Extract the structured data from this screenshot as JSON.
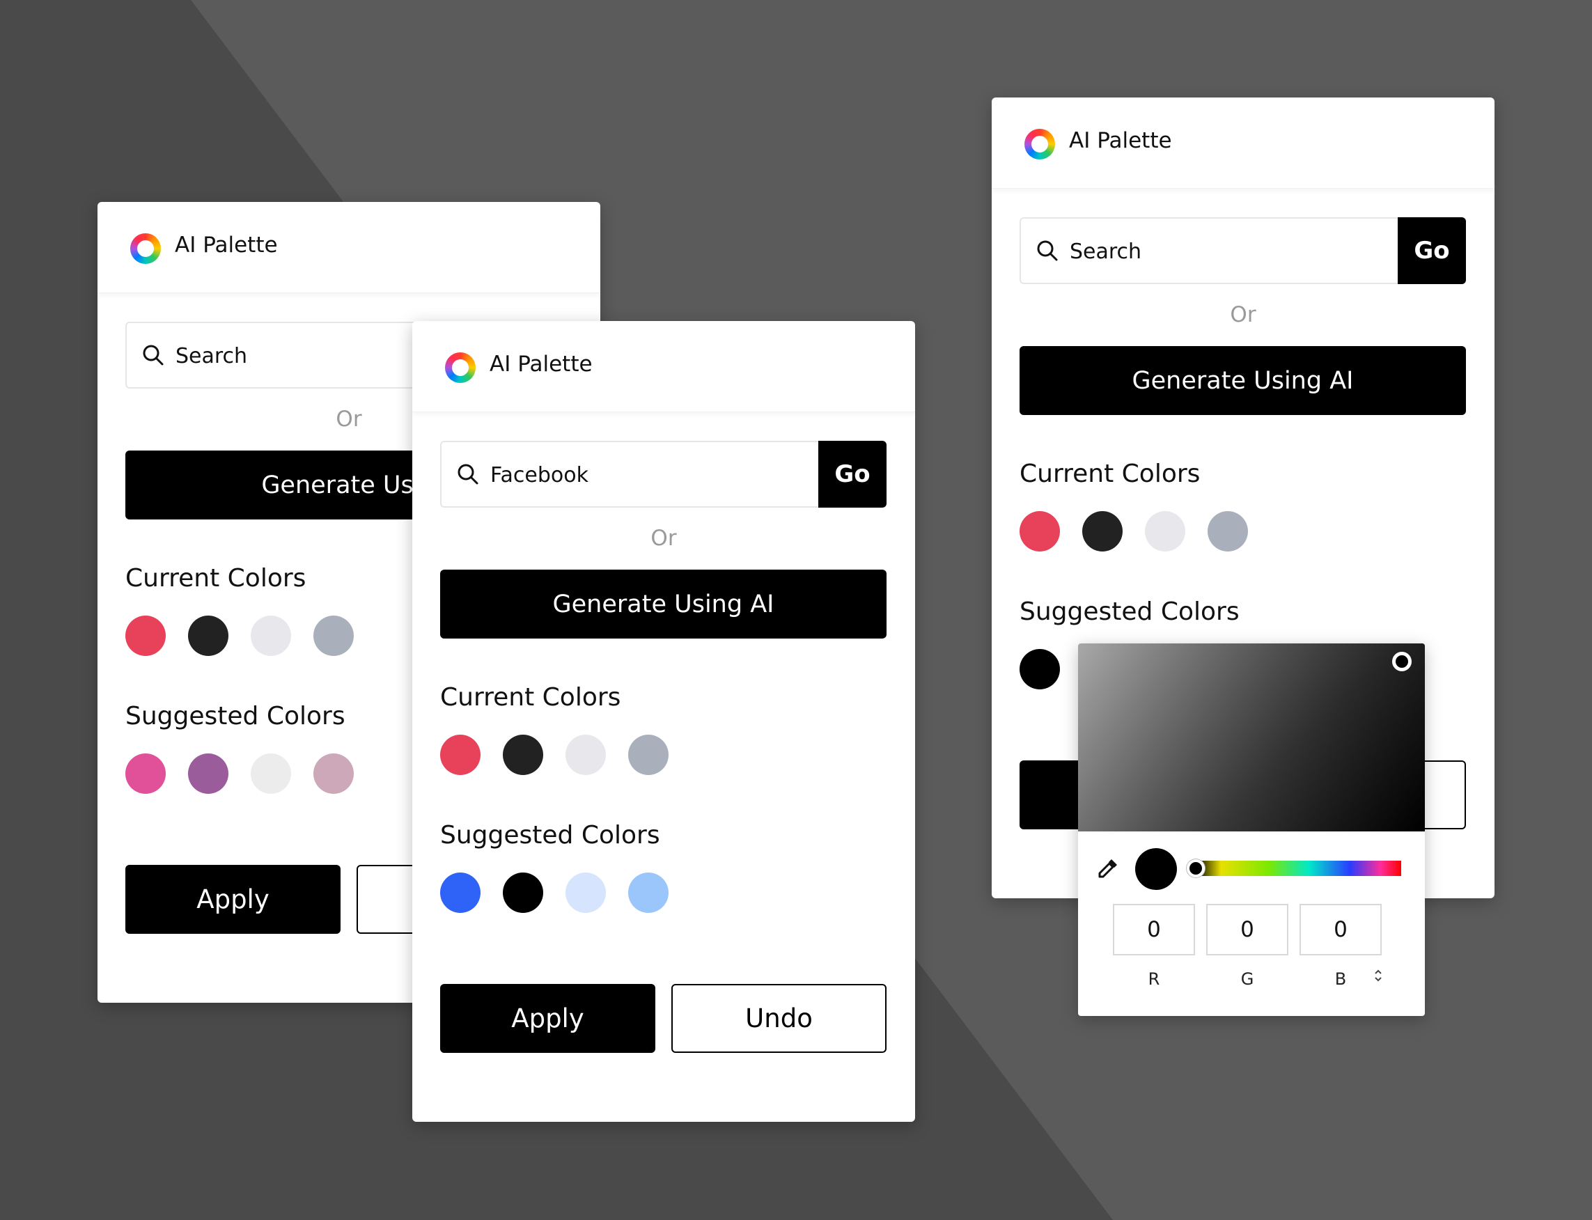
{
  "app_title": "AI Palette",
  "search_placeholder": "Search",
  "go_label": "Go",
  "or_label": "Or",
  "generate_label": "Generate Using AI",
  "current_colors_title": "Current Colors",
  "suggested_colors_title": "Suggested Colors",
  "apply_label": "Apply",
  "undo_label": "Undo",
  "panels": {
    "left": {
      "search_value": "Search",
      "generate_visible": "Generate Usin",
      "current_colors": [
        "#e8415a",
        "#222222",
        "#e8e8ec",
        "#aab0bb"
      ],
      "suggested_colors": [
        "#e0519a",
        "#9b5c9c",
        "#ececec",
        "#cda8b8"
      ]
    },
    "middle": {
      "search_value": "Facebook",
      "current_colors": [
        "#e8415a",
        "#222222",
        "#e8e8ec",
        "#aab0bb"
      ],
      "suggested_colors": [
        "#2f63f7",
        "#000000",
        "#d6e4fd",
        "#9bc6fb"
      ]
    },
    "right": {
      "search_value": "Search",
      "current_colors": [
        "#e8415a",
        "#222222",
        "#e8e8ec",
        "#aab0bb"
      ],
      "suggested_colors": [
        "#000000"
      ]
    }
  },
  "color_picker": {
    "r": "0",
    "g": "0",
    "b": "0",
    "r_label": "R",
    "g_label": "G",
    "b_label": "B",
    "selected_color": "#000000"
  }
}
